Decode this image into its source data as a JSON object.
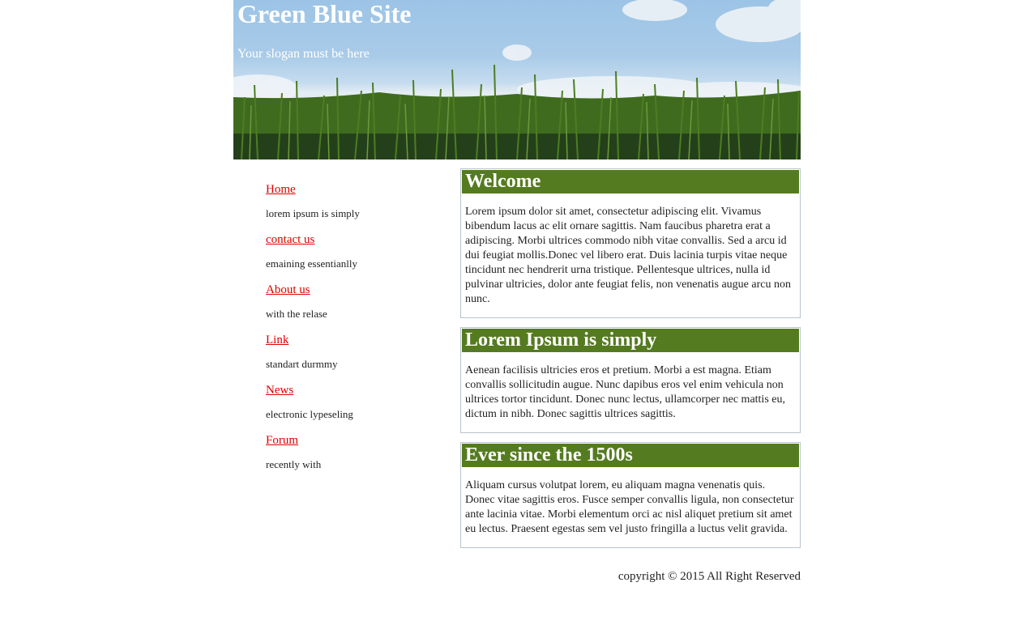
{
  "header": {
    "title": "Green Blue Site",
    "slogan": "Your slogan must be here"
  },
  "sidebar": {
    "items": [
      {
        "label": "Home",
        "description": "lorem ipsum is simply"
      },
      {
        "label": "contact us",
        "description": "emaining essentianlly"
      },
      {
        "label": "About us",
        "description": "with the relase"
      },
      {
        "label": "Link",
        "description": "standart durmmy"
      },
      {
        "label": "News",
        "description": "electronic lypeseling"
      },
      {
        "label": "Forum",
        "description": "recently with"
      }
    ]
  },
  "main": {
    "boxes": [
      {
        "title": "Welcome",
        "text": "Lorem ipsum dolor sit amet, consectetur adipiscing elit. Vivamus bibendum lacus ac elit ornare sagittis. Nam faucibus pharetra erat a adipiscing. Morbi ultrices commodo nibh vitae convallis. Sed a arcu id dui feugiat mollis.Donec vel libero erat. Duis lacinia turpis vitae neque tincidunt nec hendrerit urna tristique. Pellentesque ultrices, nulla id pulvinar ultricies, dolor ante feugiat felis, non venenatis augue arcu non nunc."
      },
      {
        "title": "Lorem Ipsum is simply",
        "text": "Aenean facilisis ultricies eros et pretium. Morbi a est magna. Etiam convallis sollicitudin augue. Nunc dapibus eros vel enim vehicula non ultrices tortor tincidunt. Donec nunc lectus, ullamcorper nec mattis eu, dictum in nibh. Donec sagittis ultrices sagittis."
      },
      {
        "title": "Ever since the 1500s",
        "text": "Aliquam cursus volutpat lorem, eu aliquam magna venenatis quis. Donec vitae sagittis eros. Fusce semper convallis ligula, non consectetur ante lacinia vitae. Morbi elementum orci ac nisl aliquet pretium sit amet eu lectus. Praesent egestas sem vel justo fringilla a luctus velit gravida."
      }
    ]
  },
  "footer": {
    "copyright": "copyright © 2015 All Right Reserved"
  },
  "colors": {
    "title_bar": "#557b20",
    "link": "#dd0000",
    "box_border": "#b9c4cc",
    "sky": "#9cc4e6",
    "grass": "#3f6b1e"
  }
}
